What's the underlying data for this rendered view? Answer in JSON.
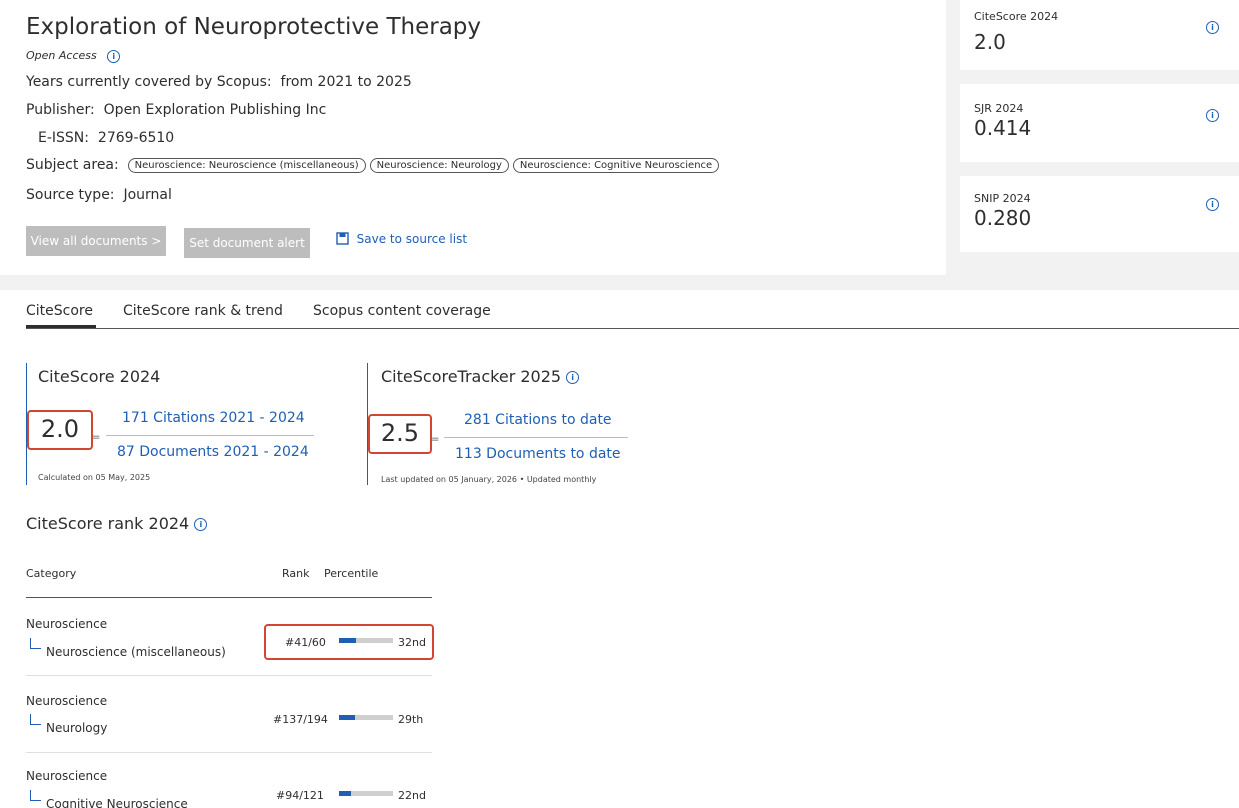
{
  "header": {
    "title": "Exploration of Neuroprotective Therapy",
    "open_access": "Open Access",
    "years_label": "Years currently covered by Scopus:",
    "years_value": "from 2021 to 2025",
    "publisher_label": "Publisher:",
    "publisher_value": "Open Exploration Publishing Inc",
    "eissn_label": "E-ISSN:",
    "eissn_value": "2769-6510",
    "subject_label": "Subject area:",
    "subjects": [
      "Neuroscience: Neuroscience (miscellaneous)",
      "Neuroscience: Neurology",
      "Neuroscience: Cognitive Neuroscience"
    ],
    "source_type_label": "Source type:",
    "source_type_value": "Journal",
    "view_all_label": "View all documents >",
    "set_alert_label": "Set document alert",
    "save_label": "Save to source list"
  },
  "metrics": [
    {
      "label": "CiteScore 2024",
      "value": "2.0"
    },
    {
      "label": "SJR 2024",
      "value": "0.414"
    },
    {
      "label": "SNIP 2024",
      "value": "0.280"
    }
  ],
  "tabs": [
    {
      "label": "CiteScore"
    },
    {
      "label": "CiteScore rank & trend"
    },
    {
      "label": "Scopus content coverage"
    }
  ],
  "citescore": {
    "title": "CiteScore 2024",
    "value": "2.0",
    "eq": "=",
    "numerator": "171 Citations 2021 - 2024",
    "denominator": "87 Documents 2021 - 2024",
    "note": "Calculated on 05 May, 2025"
  },
  "tracker": {
    "title": "CiteScoreTracker 2025",
    "value": "2.5",
    "eq": "=",
    "numerator": "281 Citations to date",
    "denominator": "113 Documents to date",
    "note": "Last updated on 05 January, 2026 • Updated monthly"
  },
  "rank": {
    "title": "CiteScore rank 2024",
    "col_category": "Category",
    "col_rank": "Rank",
    "col_percentile": "Percentile",
    "rows": [
      {
        "category": "Neuroscience",
        "sub": "Neuroscience (miscellaneous)",
        "rank": "#41/60",
        "percentile": "32nd",
        "pct_value": 32
      },
      {
        "category": "Neuroscience",
        "sub": "Neurology",
        "rank": "#137/194",
        "percentile": "29th",
        "pct_value": 29
      },
      {
        "category": "Neuroscience",
        "sub": "Cognitive Neuroscience",
        "rank": "#94/121",
        "percentile": "22nd",
        "pct_value": 22
      }
    ]
  },
  "colors": {
    "accent": "#1e5fb4",
    "highlight": "#d14632"
  }
}
